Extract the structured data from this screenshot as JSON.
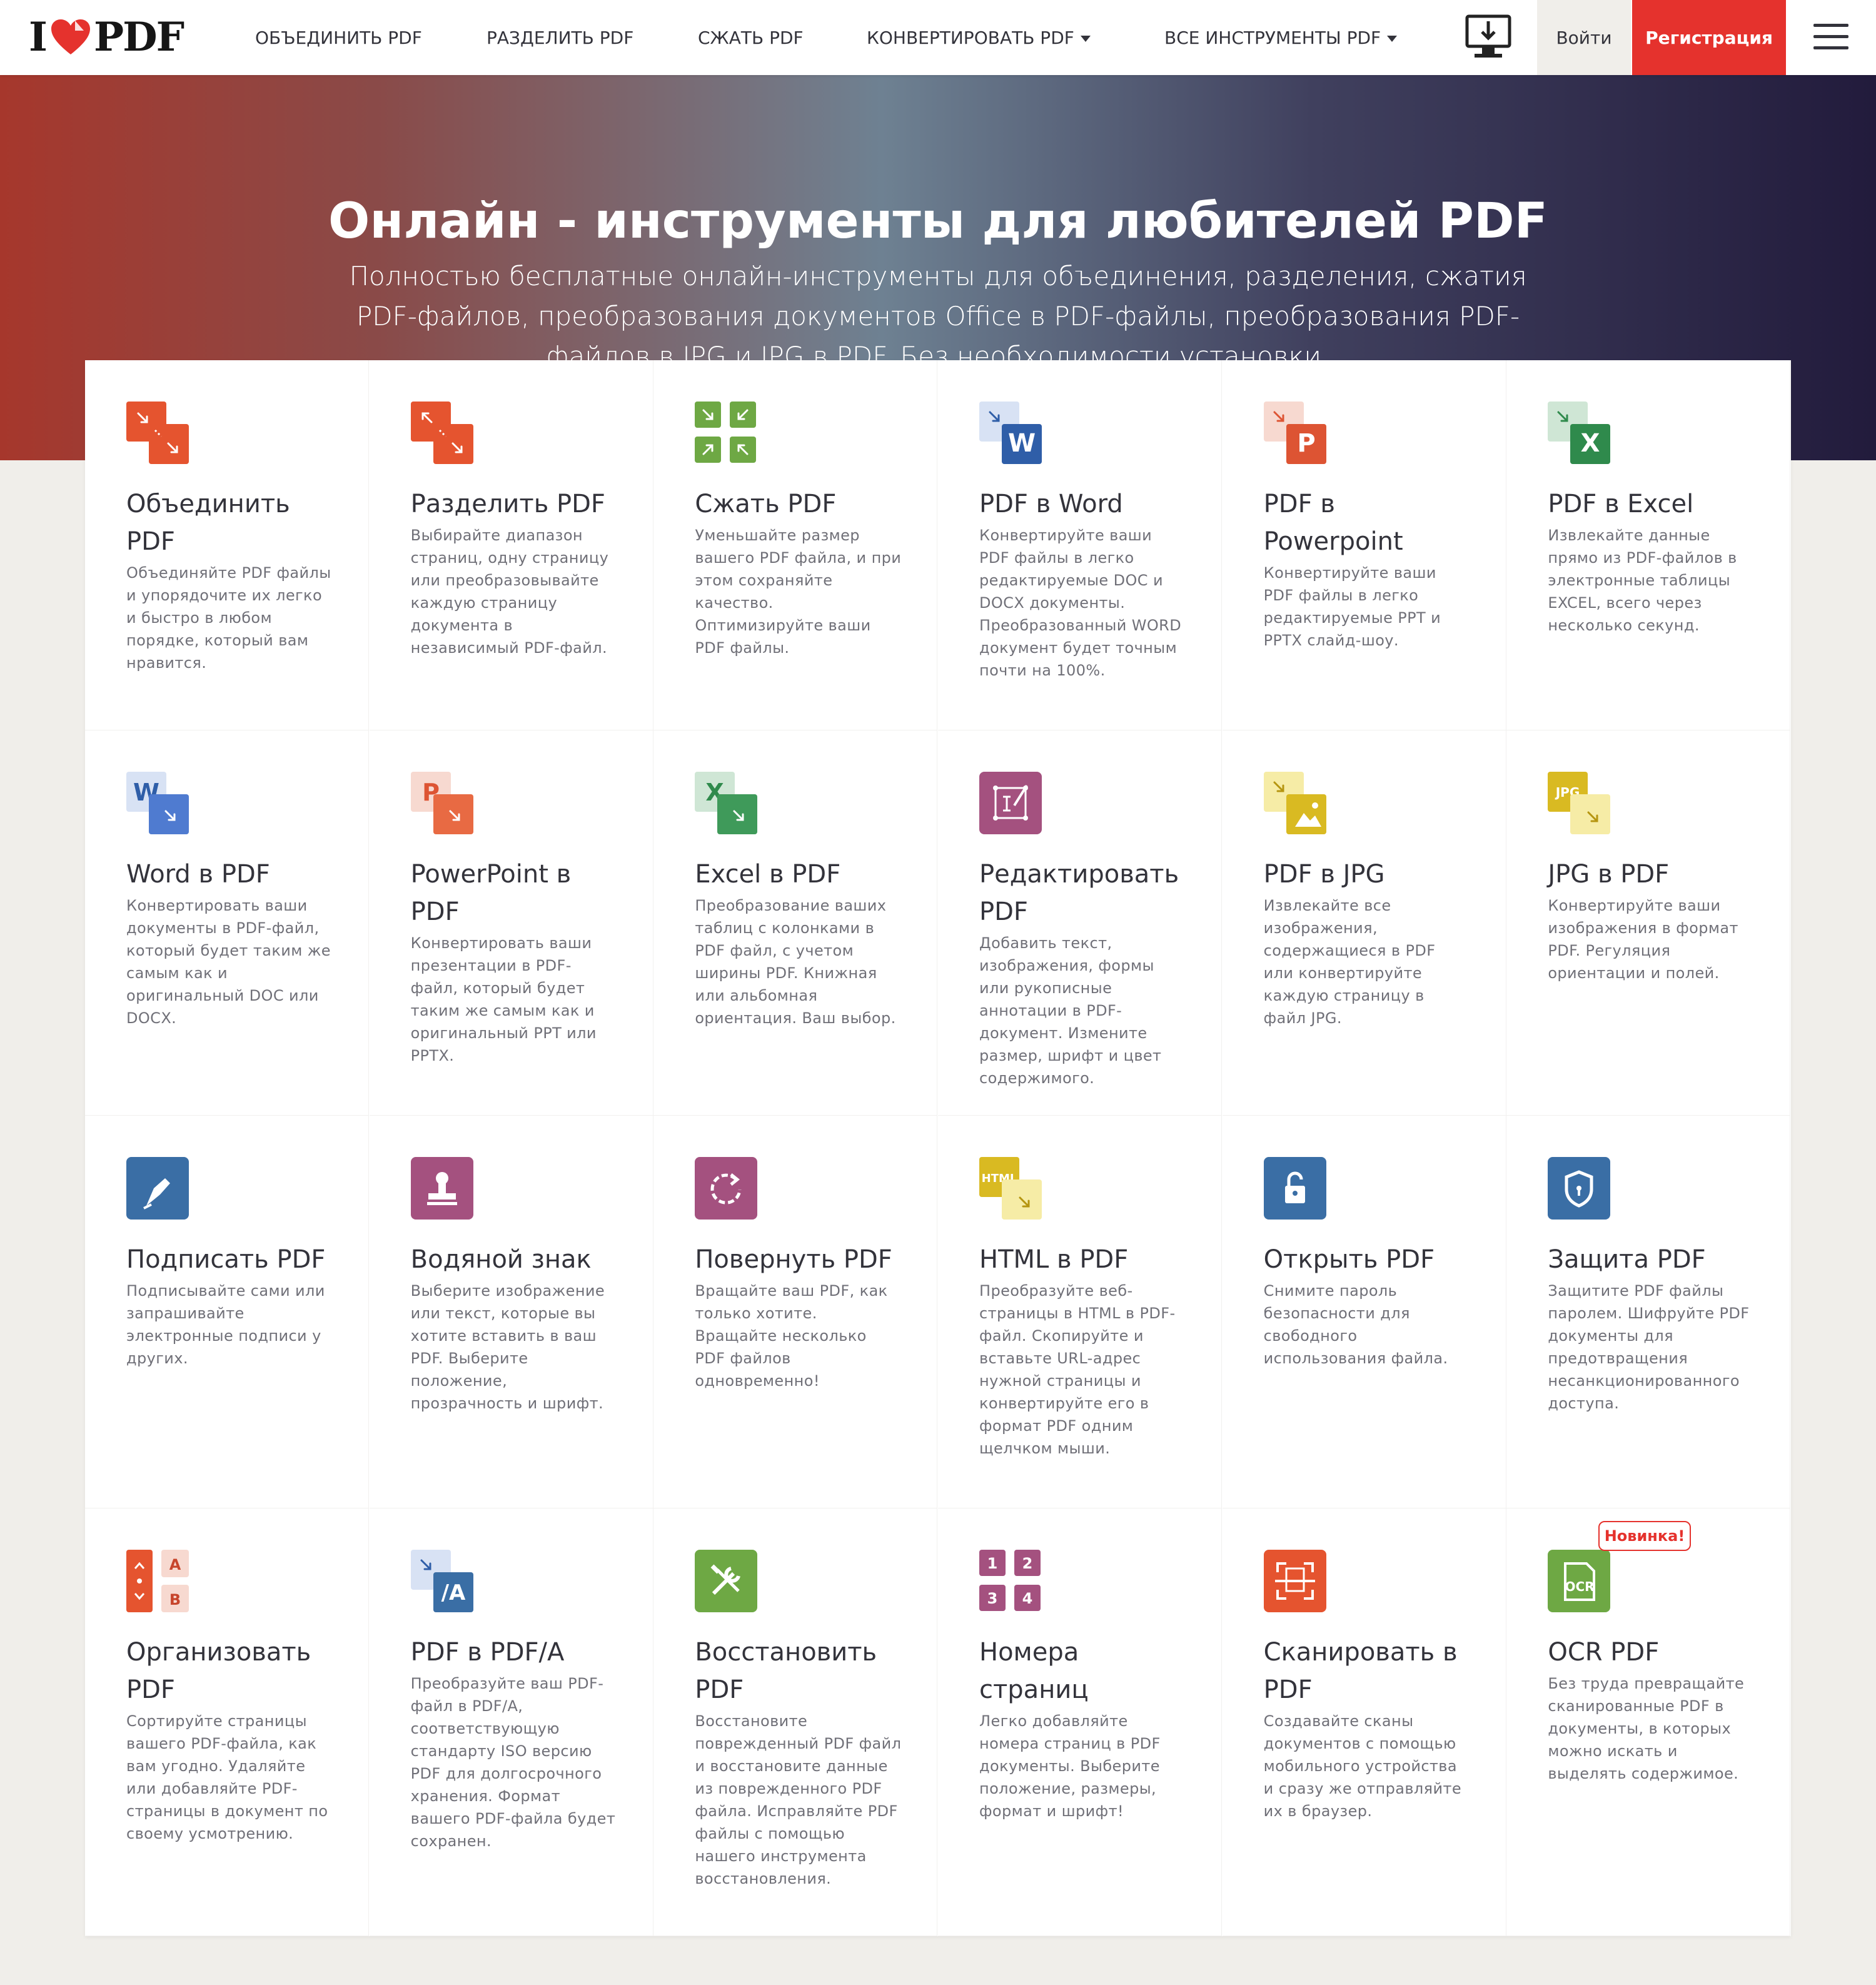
{
  "header": {
    "logo_left": "I",
    "logo_right": "PDF",
    "nav": [
      {
        "label": "ОБЪЕДИНИТЬ PDF",
        "dropdown": false
      },
      {
        "label": "РАЗДЕЛИТЬ PDF",
        "dropdown": false
      },
      {
        "label": "СЖАТЬ PDF",
        "dropdown": false
      },
      {
        "label": "КОНВЕРТИРОВАТЬ PDF",
        "dropdown": true
      },
      {
        "label": "ВСЕ ИНСТРУМЕНТЫ PDF",
        "dropdown": true
      }
    ],
    "login": "Войти",
    "signup": "Регистрация"
  },
  "hero": {
    "title": "Онлайн - инструменты для любителей PDF",
    "subtitle": "Полностью бесплатные онлайн-инструменты для объединения, разделения, сжатия PDF-файлов, преобразования документов Office в PDF-файлы, преобразования PDF-файлов в JPG и JPG в PDF. Без необходимости установки."
  },
  "colors": {
    "accent": "#e5322d",
    "merge": "#e5542f",
    "compress": "#6ea844",
    "word": "#2f5ea8",
    "ppt": "#dd5433",
    "excel": "#2f8a4c",
    "edit": "#a4517f",
    "jpg": "#d9ba22",
    "sign": "#3a6ea5",
    "purple": "#a4517f"
  },
  "tools": [
    {
      "title": "Объединить PDF",
      "desc": "Объединяйте PDF файлы и упорядочите их легко и быстро в любом порядке, который вам нравится.",
      "icon": "merge-icon"
    },
    {
      "title": "Разделить PDF",
      "desc": "Выбирайте диапазон страниц, одну страницу или преобразовывайте каждую страницу документа в независимый PDF-файл.",
      "icon": "split-icon"
    },
    {
      "title": "Сжать PDF",
      "desc": "Уменьшайте размер вашего PDF файла, и при этом сохраняйте качество. Оптимизируйте ваши PDF файлы.",
      "icon": "compress-icon"
    },
    {
      "title": "PDF в Word",
      "desc": "Конвертируйте ваши PDF файлы в легко редактируемые DOC и DOCX документы. Преобразованный WORD документ будет точным почти на 100%.",
      "icon": "pdf-to-word-icon",
      "letter": "W"
    },
    {
      "title": "PDF в Powerpoint",
      "desc": "Конвертируйте ваши PDF файлы в легко редактируемые PPT и PPTX слайд-шоу.",
      "icon": "pdf-to-powerpoint-icon",
      "letter": "P"
    },
    {
      "title": "PDF в Excel",
      "desc": "Извлекайте данные прямо из PDF-файлов в электронные таблицы EXCEL, всего через несколько секунд.",
      "icon": "pdf-to-excel-icon",
      "letter": "X"
    },
    {
      "title": "Word в PDF",
      "desc": "Конвертировать ваши документы в PDF-файл, который будет таким же самым как и оригинальный DOC или DOCX.",
      "icon": "word-to-pdf-icon",
      "letter": "W"
    },
    {
      "title": "PowerPoint в PDF",
      "desc": "Конвертировать ваши презентации в PDF-файл, который будет таким же самым как и оригинальный PPT или PPTX.",
      "icon": "powerpoint-to-pdf-icon",
      "letter": "P"
    },
    {
      "title": "Excel в PDF",
      "desc": "Преобразование ваших таблиц с колонками в PDF файл, с учетом ширины PDF. Книжная или альбомная ориентация. Ваш выбор.",
      "icon": "excel-to-pdf-icon",
      "letter": "X"
    },
    {
      "title": "Редактировать PDF",
      "desc": "Добавить текст, изображения, формы или рукописные аннотации в PDF-документ. Измените размер, шрифт и цвет содержимого.",
      "icon": "edit-pdf-icon"
    },
    {
      "title": "PDF в JPG",
      "desc": "Извлекайте все изображения, содержащиеся в PDF или конвертируйте каждую страницу в файл JPG.",
      "icon": "pdf-to-jpg-icon"
    },
    {
      "title": "JPG в PDF",
      "desc": "Конвертируйте ваши изображения в формат PDF. Регуляция ориентации и полей.",
      "icon": "jpg-to-pdf-icon",
      "letter": "JPG"
    },
    {
      "title": "Подписать PDF",
      "desc": "Подписывайте сами или запрашивайте электронные подписи у других.",
      "icon": "sign-pdf-icon"
    },
    {
      "title": "Водяной знак",
      "desc": "Выберите изображение или текст, которые вы хотите вставить в ваш PDF. Выберите положение, прозрачность и шрифт.",
      "icon": "watermark-icon"
    },
    {
      "title": "Повернуть PDF",
      "desc": "Вращайте ваш PDF, как только хотите. Вращайте несколько PDF файлов одновременно!",
      "icon": "rotate-pdf-icon"
    },
    {
      "title": "HTML в PDF",
      "desc": "Преобразуйте веб-страницы в HTML в PDF-файл. Скопируйте и вставьте URL-адрес нужной страницы и конвертируйте его в формат PDF одним щелчком мыши.",
      "icon": "html-to-pdf-icon",
      "letter": "HTML"
    },
    {
      "title": "Открыть PDF",
      "desc": "Снимите пароль безопасности для свободного использования файла.",
      "icon": "unlock-pdf-icon"
    },
    {
      "title": "Защита PDF",
      "desc": "Защитите PDF файлы паролем. Шифруйте PDF документы для предотвращения несанкционированного доступа.",
      "icon": "protect-pdf-icon"
    },
    {
      "title": "Организовать PDF",
      "desc": "Сортируйте страницы вашего PDF-файла, как вам угодно. Удаляйте или добавляйте PDF-страницы в документ по своему усмотрению.",
      "icon": "organize-pdf-icon",
      "letter": "A",
      "letter2": "B"
    },
    {
      "title": "PDF в PDF/A",
      "desc": "Преобразуйте ваш PDF-файл в PDF/A, соответствующую стандарту ISO версию PDF для долгосрочного хранения. Формат вашего PDF-файла будет сохранен.",
      "icon": "pdf-to-pdfa-icon",
      "letter": "/A"
    },
    {
      "title": "Восстановить PDF",
      "desc": "Восстановите поврежденный PDF файл и восстановите данные из поврежденного PDF файла. Исправляйте PDF файлы с помощью нашего инструмента восстановления.",
      "icon": "repair-pdf-icon"
    },
    {
      "title": "Номера страниц",
      "desc": "Легко добавляйте номера страниц в PDF документы. Выберите положение, размеры, формат и шрифт!",
      "icon": "page-numbers-icon",
      "numbers": [
        "1",
        "2",
        "3",
        "4"
      ]
    },
    {
      "title": "Сканировать в PDF",
      "desc": "Создавайте сканы документов с помощью мобильного устройства и сразу же отправляйте их в браузер.",
      "icon": "scan-to-pdf-icon"
    },
    {
      "title": "OCR PDF",
      "desc": "Без труда превращайте сканированные PDF в документы, в которых можно искать и выделять содержимое.",
      "icon": "ocr-pdf-icon",
      "letter": "OCR",
      "badge": "Новинка!"
    }
  ]
}
